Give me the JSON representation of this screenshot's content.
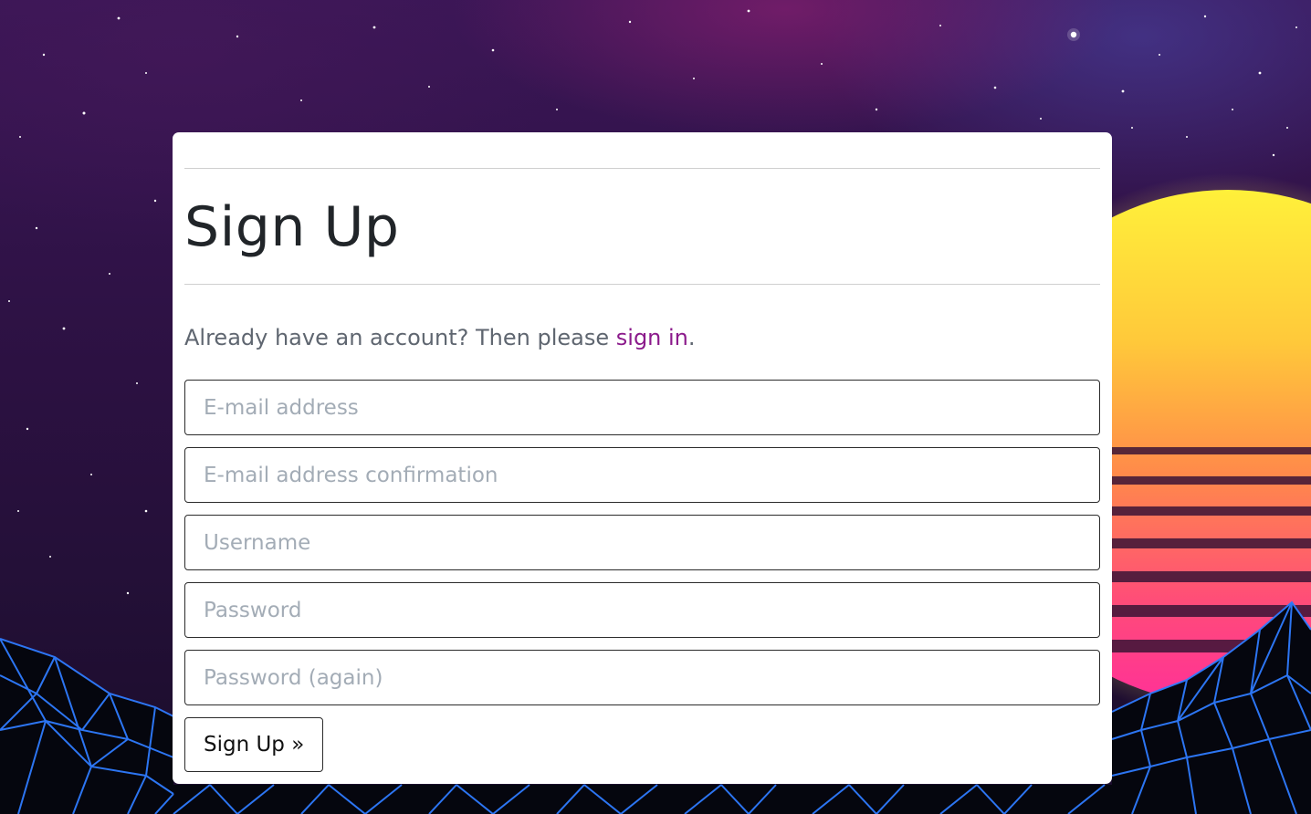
{
  "page": {
    "title": "Sign Up",
    "signin_prompt": "Already have an account? Then please ",
    "signin_link": "sign in",
    "signin_suffix": "."
  },
  "form": {
    "email_placeholder": "E-mail address",
    "email_confirm_placeholder": "E-mail address confirmation",
    "username_placeholder": "Username",
    "password_placeholder": "Password",
    "password_again_placeholder": "Password (again)",
    "submit_label": "Sign Up »"
  },
  "colors": {
    "link": "#8b1a8b",
    "heading": "#212529",
    "body_text": "#5f6670",
    "placeholder": "#a3acb6",
    "card_bg": "#ffffff",
    "grid_lines": "#2f7bff",
    "sun_top": "#fff23a",
    "sun_bottom": "#ff2f9a"
  },
  "background": {
    "scene": "synthwave-night-sky",
    "elements": [
      "stars",
      "striped-sun",
      "wireframe-mountains"
    ]
  }
}
